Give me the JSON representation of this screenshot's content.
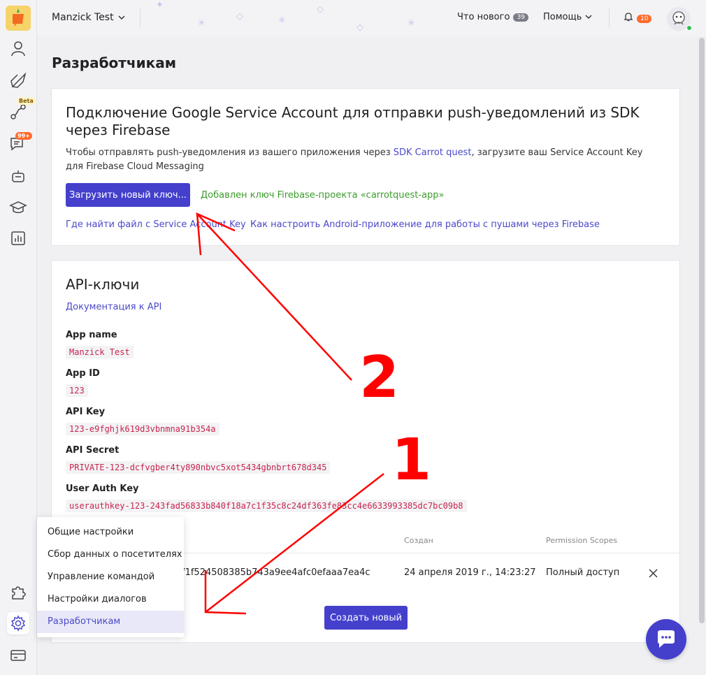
{
  "topbar": {
    "project": "Manzick Test",
    "whats_new": "Что нового",
    "whats_new_count": "39",
    "help": "Помощь",
    "notifications_count": "10"
  },
  "sidebar": {
    "beta_badge": "Beta",
    "chat_badge": "99+"
  },
  "page": {
    "title": "Разработчикам"
  },
  "firebase": {
    "title": "Подключение Google Service Account для отправки push-уведомлений из SDK через Firebase",
    "desc_prefix": "Чтобы отправлять push-уведомления из вашего приложения через ",
    "desc_link": "SDK Carrot quest",
    "desc_suffix": ", загрузите ваш Service Account Key для Firebase Cloud Messaging",
    "upload_button": "Загрузить новый ключ...",
    "added_text": "Добавлен ключ Firebase-проекта «carrotquest-app»",
    "link_find": "Где найти файл с Service Account Key",
    "link_android": "Как настроить Android-приложение для работы с пушами через Firebase"
  },
  "api": {
    "title": "API-ключи",
    "docs_link": "Документация к API",
    "fields": [
      {
        "label": "App name",
        "value": "Manzick Test"
      },
      {
        "label": "App ID",
        "value": "123"
      },
      {
        "label": "API Key",
        "value": "123-e9fghjk619d3vbnmna91b354a"
      },
      {
        "label": "API Secret",
        "value": "PRIVATE-123-dcfvgber4ty890nbvc5xot5434gbnbrt678d345"
      },
      {
        "label": "User Auth Key",
        "value": "userauthkey-123-243fad56833b840f18a7c1f35c8c24df363fe83cc4e6633993385dc7bc09b8"
      }
    ],
    "table": {
      "col_created": "Создан",
      "col_scopes": "Permission Scopes",
      "row_token_partial": "f1f524508385b743a9ee4afc0efaaa7ea4c",
      "row_created": "24 апреля 2019 г., 14:23:27",
      "row_scopes": "Полный доступ"
    },
    "create_button": "Создать новый"
  },
  "settings_menu": [
    "Общие настройки",
    "Сбор данных о посетителях",
    "Управление командой",
    "Настройки диалогов",
    "Разработчикам"
  ],
  "annotations": {
    "num_one": "1",
    "num_two": "2"
  },
  "colors": {
    "accent": "#4440cc",
    "link": "#4b49c9",
    "success": "#3a9c2a",
    "annotation": "#ff0000",
    "code": "#c7254e"
  }
}
